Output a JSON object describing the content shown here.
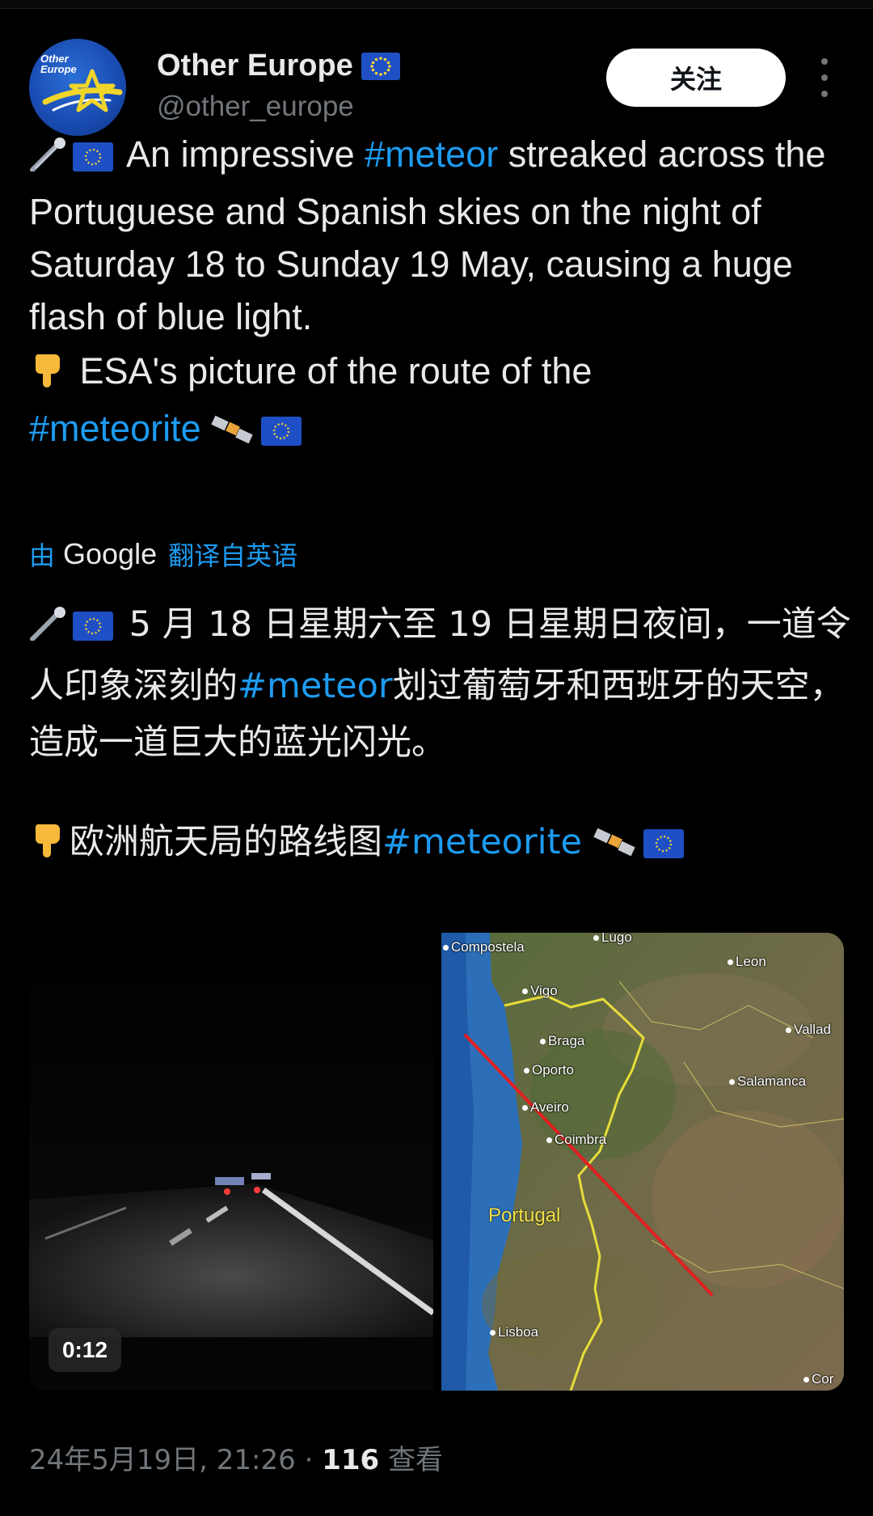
{
  "account": {
    "display_name": "Other Europe",
    "handle": "@other_europe",
    "avatar_text_line1": "Other",
    "avatar_text_line2": "Europe",
    "verified_flag_icon": "eu-flag-icon"
  },
  "actions": {
    "follow_label": "关注",
    "more_icon": "more-vertical-icon"
  },
  "tweet": {
    "p1_before": " An impressive ",
    "p1_hashtag": "#meteor",
    "p1_after": " streaked across the Portuguese and Spanish skies on the night of Saturday 18 to Sunday 19 May, causing a huge flash of blue light.",
    "p2_text": " ESA's picture of the route of the ",
    "p2_hashtag": "#meteorite",
    "emoji_comet": "comet-emoji",
    "emoji_eu": "eu-flag-emoji",
    "emoji_point_down": "point-down-emoji",
    "emoji_satellite": "satellite-emoji"
  },
  "translation": {
    "by_label": "由",
    "provider": "Google",
    "from_label": "翻译自英语",
    "p1_before": " 5 月 18 日星期六至 19 日星期日夜间，一道令人印象深刻的",
    "p1_hashtag": "#meteor",
    "p1_after": "划过葡萄牙和西班牙的天空，造成一道巨大的蓝光闪光。",
    "p2_text": "欧洲航天局的路线图",
    "p2_hashtag": "#meteorite"
  },
  "media": {
    "video_duration": "0:12",
    "map_labels": {
      "compostela": "Compostela",
      "lugo": "Lugo",
      "leon": "Leon",
      "vigo": "Vigo",
      "braga": "Braga",
      "valladolid": "Vallad",
      "oporto": "Oporto",
      "salamanca": "Salamanca",
      "aveiro": "Aveiro",
      "coimbra": "Coimbra",
      "portugal": "Portugal",
      "lisboa": "Lisboa",
      "cordoba": "Cor"
    },
    "meteor_path_color": "#e02020",
    "border_color": "#e6dc3a"
  },
  "footer": {
    "timestamp": "24年5月19日, 21:26",
    "separator": " · ",
    "views_count": "116",
    "views_label": " 查看"
  }
}
